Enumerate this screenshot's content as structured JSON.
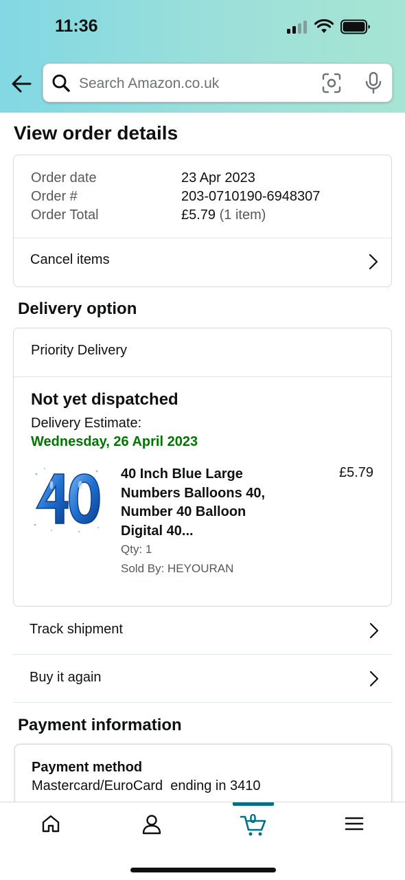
{
  "status_bar": {
    "time": "11:36"
  },
  "header": {
    "search_placeholder": "Search Amazon.co.uk",
    "accent_color": "#82d8e3"
  },
  "page_title": "View order details",
  "order_summary": {
    "date_label": "Order date",
    "date_value": "23 Apr 2023",
    "number_label": "Order #",
    "number_value": "203-0710190-6948307",
    "total_label": "Order Total",
    "total_value": "£5.79",
    "total_items": "(1 item)",
    "cancel_label": "Cancel items"
  },
  "delivery": {
    "section_title": "Delivery option",
    "option": "Priority Delivery",
    "status": "Not yet dispatched",
    "estimate_label": "Delivery Estimate:",
    "estimate_date": "Wednesday, 26 April 2023",
    "estimate_color": "#007600",
    "product": {
      "title": "40 Inch Blue Large Numbers Balloons 40, Number 40 Balloon Digital 40...",
      "price": "£5.79",
      "qty": "Qty: 1",
      "seller": "Sold By: HEYOURAN",
      "image_text": "40"
    }
  },
  "actions": {
    "track_label": "Track shipment",
    "buy_again_label": "Buy it again"
  },
  "payment": {
    "section_title": "Payment information",
    "method_label": "Payment method",
    "method_value": "Mastercard/EuroCard  ending in 3410"
  },
  "bottom_nav": {
    "items": [
      "home-icon",
      "account-icon",
      "cart-icon",
      "menu-icon"
    ],
    "cart_count": "0",
    "active_color": "#007185"
  }
}
